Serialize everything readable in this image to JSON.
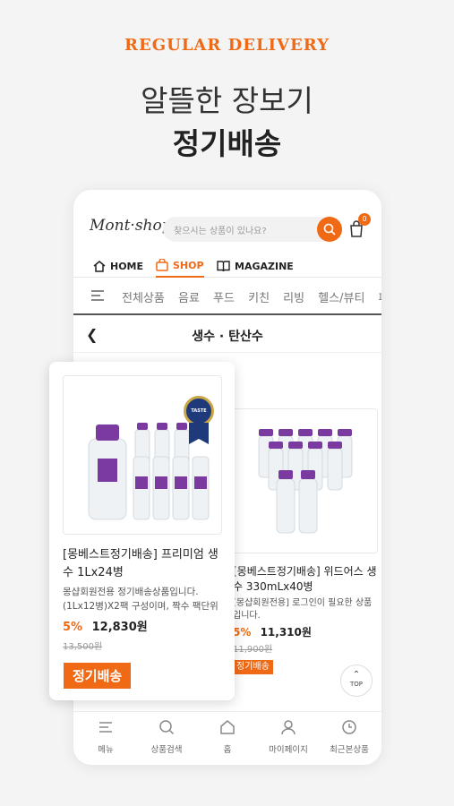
{
  "promo": {
    "eyebrow": "REGULAR DELIVERY",
    "headline_1": "알뜰한 장보기",
    "headline_2": "정기배송"
  },
  "header": {
    "logo": "Mont·shop",
    "search_placeholder": "찾으시는 상품이 있나요?",
    "cart_count": "0"
  },
  "main_tabs": [
    {
      "label": "HOME",
      "icon": "home-icon"
    },
    {
      "label": "SHOP",
      "icon": "shopping-bag-icon"
    },
    {
      "label": "MAGAZINE",
      "icon": "book-icon"
    }
  ],
  "categories": [
    "전체상품",
    "음료",
    "푸드",
    "키친",
    "리빙",
    "헬스/뷰티",
    "패"
  ],
  "sub_header": {
    "title": "생수 · 탄산수"
  },
  "products": [
    {
      "title": "[몽베스트정기배송] 프리미엄 생수 1Lx24병",
      "desc": "몽샵회원전용 정기배송상품입니다. (1Lx12병)X2팩 구성이며, 짝수 팩단위",
      "discount": "5%",
      "price": "12,830원",
      "original": "13,500원",
      "tag": "정기배송",
      "badge_text": "TASTE"
    },
    {
      "title": "[몽베스트정기배송] 위드어스 생수 330mLx40병",
      "desc": "[몽샵회원전용] 로그인이 필요한 상품입니다.",
      "discount": "5%",
      "price": "11,310원",
      "original": "11,900원",
      "tag": "정기배송"
    }
  ],
  "top_button": "TOP",
  "bottom_nav": [
    {
      "label": "메뉴",
      "icon": "menu-icon"
    },
    {
      "label": "상품검색",
      "icon": "search-icon"
    },
    {
      "label": "홈",
      "icon": "home-icon"
    },
    {
      "label": "마이페이지",
      "icon": "user-icon"
    },
    {
      "label": "최근본상품",
      "icon": "clock-icon"
    }
  ],
  "colors": {
    "accent": "#f06a16",
    "bottle_label": "#7b3aa0"
  }
}
